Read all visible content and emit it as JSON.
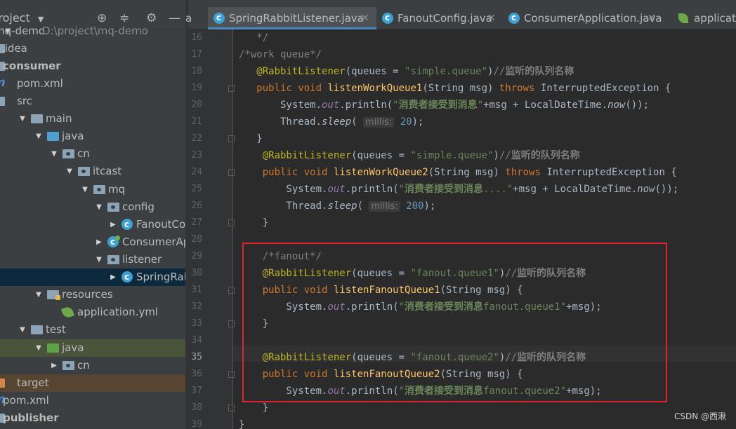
{
  "project_panel": {
    "title": "Project",
    "tree": [
      {
        "label": "mq-demo",
        "path": "D:\\project\\mq-demo",
        "icon": "module-folder-icon",
        "indent": 0,
        "expanded": true
      },
      {
        "label": ".idea",
        "icon": "folder-icon",
        "indent": 0
      },
      {
        "label": "consumer",
        "icon": "module-folder-icon",
        "indent": 0,
        "bold": true
      },
      {
        "label": "pom.xml",
        "icon": "maven-icon",
        "indent": 0
      },
      {
        "label": "src",
        "icon": "folder-icon",
        "indent": 0
      },
      {
        "label": "main",
        "icon": "folder-icon",
        "indent": 1,
        "expanded": true
      },
      {
        "label": "java",
        "icon": "source-folder-icon",
        "indent": 2,
        "expanded": true
      },
      {
        "label": "cn",
        "icon": "package-icon",
        "indent": 3,
        "expanded": true
      },
      {
        "label": "itcast",
        "icon": "package-icon",
        "indent": 4,
        "expanded": true
      },
      {
        "label": "mq",
        "icon": "package-icon",
        "indent": 5,
        "expanded": true
      },
      {
        "label": "config",
        "icon": "package-icon",
        "indent": 6,
        "expanded": true
      },
      {
        "label": "FanoutConfig",
        "icon": "class-icon",
        "indent": 7,
        "collapsed": true
      },
      {
        "label": "ConsumerApplication",
        "icon": "spring-app-class-icon",
        "indent": 6,
        "collapsed": true
      },
      {
        "label": "listener",
        "icon": "package-icon",
        "indent": 6,
        "expanded": true
      },
      {
        "label": "SpringRabbitListener",
        "icon": "class-icon",
        "indent": 7,
        "collapsed": true,
        "selected": true
      },
      {
        "label": "resources",
        "icon": "resources-folder-icon",
        "indent": 2,
        "expanded": true
      },
      {
        "label": "application.yml",
        "icon": "spring-config-icon",
        "indent": 3
      },
      {
        "label": "test",
        "icon": "folder-icon",
        "indent": 1,
        "expanded": true
      },
      {
        "label": "java",
        "icon": "test-folder-icon",
        "indent": 2,
        "expanded": true
      },
      {
        "label": "cn",
        "icon": "package-icon",
        "indent": 3,
        "collapsed": true
      },
      {
        "label": "target",
        "icon": "excluded-folder-icon",
        "indent": 0
      },
      {
        "label": "pom.xml",
        "icon": "maven-icon",
        "indent": 0
      },
      {
        "label": "publisher",
        "icon": "module-folder-icon",
        "indent": 0,
        "bold": true
      }
    ]
  },
  "tabs": [
    {
      "label": "a",
      "icon": "none",
      "active": false
    },
    {
      "label": "SpringRabbitListener.java",
      "icon": "class-icon",
      "active": true
    },
    {
      "label": "FanoutConfig.java",
      "icon": "class-icon",
      "active": false
    },
    {
      "label": "ConsumerApplication.java",
      "icon": "spring-app-class-icon",
      "active": false
    },
    {
      "label": "applicat",
      "icon": "spring-config-icon",
      "active": false
    }
  ],
  "editor": {
    "current_line": 35,
    "lines": [
      {
        "n": 16,
        "tokens": [
          [
            "cm",
            "   */"
          ]
        ]
      },
      {
        "n": 17,
        "tokens": [
          [
            "cm",
            "/*work queue*/"
          ]
        ]
      },
      {
        "n": 18,
        "tokens": [
          [
            "t",
            "   "
          ],
          [
            "an",
            "@RabbitListener"
          ],
          [
            "t",
            "(queues = "
          ],
          [
            "st",
            "\"simple.queue\""
          ],
          [
            "t",
            ")"
          ],
          [
            "cm",
            "//"
          ],
          [
            "cmzh",
            "监听的队列名称"
          ]
        ]
      },
      {
        "n": 19,
        "tokens": [
          [
            "t",
            "   "
          ],
          [
            "kw",
            "public void "
          ],
          [
            "fn",
            "listenWorkQueue1"
          ],
          [
            "t",
            "(String msg) "
          ],
          [
            "kw",
            "throws "
          ],
          [
            "t",
            "InterruptedException {"
          ]
        ]
      },
      {
        "n": 20,
        "tokens": [
          [
            "t",
            "       System."
          ],
          [
            "fld",
            "out"
          ],
          [
            "t",
            ".println("
          ],
          [
            "st",
            "\""
          ],
          [
            "stzh",
            "消费者接受到消息"
          ],
          [
            "st",
            "\""
          ],
          [
            "t",
            "+msg + LocalDateTime."
          ],
          [
            "it",
            "now"
          ],
          [
            "t",
            "());"
          ]
        ]
      },
      {
        "n": 21,
        "tokens": [
          [
            "t",
            "       Thread."
          ],
          [
            "it",
            "sleep"
          ],
          [
            "t",
            "( "
          ],
          [
            "hint",
            "millis:"
          ],
          [
            "t",
            " "
          ],
          [
            "nm",
            "20"
          ],
          [
            "t",
            ");"
          ]
        ]
      },
      {
        "n": 22,
        "tokens": [
          [
            "t",
            "   }"
          ]
        ]
      },
      {
        "n": 23,
        "tokens": [
          [
            "t",
            "    "
          ],
          [
            "an",
            "@RabbitListener"
          ],
          [
            "t",
            "(queues = "
          ],
          [
            "st",
            "\"simple.queue\""
          ],
          [
            "t",
            ")"
          ],
          [
            "cm",
            "//"
          ],
          [
            "cmzh",
            "监听的队列名称"
          ]
        ]
      },
      {
        "n": 24,
        "tokens": [
          [
            "t",
            "    "
          ],
          [
            "kw",
            "public void "
          ],
          [
            "fn",
            "listenWorkQueue2"
          ],
          [
            "t",
            "(String msg) "
          ],
          [
            "kw",
            "throws "
          ],
          [
            "t",
            "InterruptedException {"
          ]
        ]
      },
      {
        "n": 25,
        "tokens": [
          [
            "t",
            "        System."
          ],
          [
            "fld",
            "out"
          ],
          [
            "t",
            ".println("
          ],
          [
            "st",
            "\""
          ],
          [
            "stzh",
            "消费者接受到消息"
          ],
          [
            "st",
            "....\""
          ],
          [
            "t",
            "+msg + LocalDateTime."
          ],
          [
            "it",
            "now"
          ],
          [
            "t",
            "());"
          ]
        ]
      },
      {
        "n": 26,
        "tokens": [
          [
            "t",
            "        Thread."
          ],
          [
            "it",
            "sleep"
          ],
          [
            "t",
            "( "
          ],
          [
            "hint",
            "millis:"
          ],
          [
            "t",
            " "
          ],
          [
            "nm",
            "200"
          ],
          [
            "t",
            ");"
          ]
        ]
      },
      {
        "n": 27,
        "tokens": [
          [
            "t",
            "    }"
          ]
        ]
      },
      {
        "n": 28,
        "tokens": []
      },
      {
        "n": 29,
        "tokens": [
          [
            "t",
            "    "
          ],
          [
            "cm",
            "/*fanout*/"
          ]
        ]
      },
      {
        "n": 30,
        "tokens": [
          [
            "t",
            "    "
          ],
          [
            "an",
            "@RabbitListener"
          ],
          [
            "t",
            "(queues = "
          ],
          [
            "st",
            "\"fanout.queue1\""
          ],
          [
            "t",
            ")"
          ],
          [
            "cm",
            "//"
          ],
          [
            "cmzh",
            "监听的队列名称"
          ]
        ]
      },
      {
        "n": 31,
        "tokens": [
          [
            "t",
            "    "
          ],
          [
            "kw",
            "public void "
          ],
          [
            "fn",
            "listenFanoutQueue1"
          ],
          [
            "t",
            "(String msg) {"
          ]
        ]
      },
      {
        "n": 32,
        "tokens": [
          [
            "t",
            "        System."
          ],
          [
            "fld",
            "out"
          ],
          [
            "t",
            ".println("
          ],
          [
            "st",
            "\""
          ],
          [
            "stzh",
            "消费者接受到消息"
          ],
          [
            "st",
            "fanout.queue1\""
          ],
          [
            "t",
            "+msg);"
          ]
        ]
      },
      {
        "n": 33,
        "tokens": [
          [
            "t",
            "    }"
          ]
        ]
      },
      {
        "n": 34,
        "tokens": []
      },
      {
        "n": 35,
        "tokens": [
          [
            "t",
            "    "
          ],
          [
            "an",
            "@RabbitListener"
          ],
          [
            "t",
            "(queues = "
          ],
          [
            "st",
            "\"fanout.queue2\""
          ],
          [
            "t",
            ")"
          ],
          [
            "cm",
            "//"
          ],
          [
            "cmzh",
            "监听的队列名称"
          ]
        ]
      },
      {
        "n": 36,
        "tokens": [
          [
            "t",
            "    "
          ],
          [
            "kw",
            "public void "
          ],
          [
            "fn",
            "listenFanoutQueue2"
          ],
          [
            "t",
            "(String msg) {"
          ]
        ]
      },
      {
        "n": 37,
        "tokens": [
          [
            "t",
            "        System."
          ],
          [
            "fld",
            "out"
          ],
          [
            "t",
            ".println("
          ],
          [
            "st",
            "\""
          ],
          [
            "stzh",
            "消费者接受到消息"
          ],
          [
            "st",
            "fanout.queue2\""
          ],
          [
            "t",
            "+msg);"
          ]
        ]
      },
      {
        "n": 38,
        "tokens": [
          [
            "t",
            "    }"
          ]
        ]
      },
      {
        "n": 39,
        "tokens": [
          [
            "t",
            "}"
          ]
        ]
      }
    ],
    "highlight_box_color": "#e0242f"
  },
  "watermark": "CSDN @西湫",
  "colors": {
    "keyword": "#cc7832",
    "annotation": "#bbb529",
    "string": "#6a8759",
    "comment": "#808080",
    "method": "#ffc66d",
    "field": "#9876aa",
    "number": "#6897bb"
  }
}
